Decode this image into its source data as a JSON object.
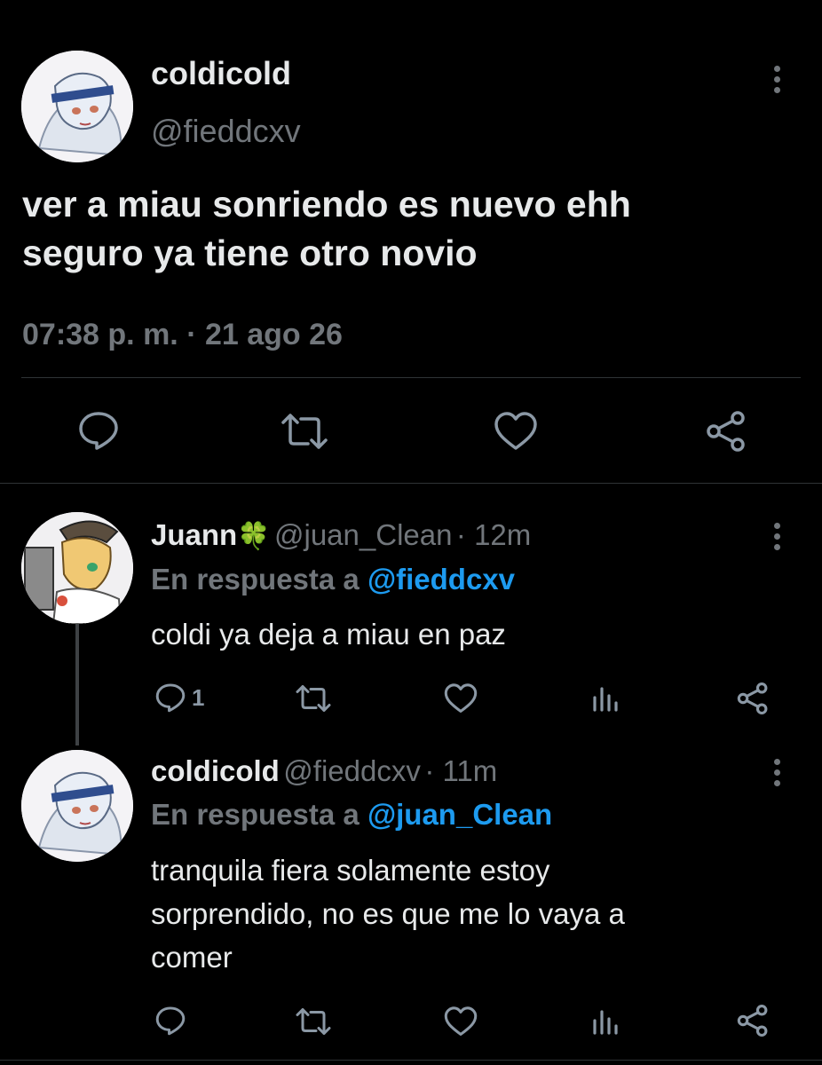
{
  "main_tweet": {
    "display_name": "coldicold",
    "handle": "@fieddcxv",
    "text_line1": "ver a miau sonriendo es nuevo ehh",
    "text_line2": "seguro ya tiene otro novio",
    "timestamp": "07:38 p. m. · 21 ago 26",
    "actions": [
      "reply-icon",
      "retweet-icon",
      "like-icon",
      "share-icon"
    ]
  },
  "replies": [
    {
      "display_name": "Juann",
      "name_emoji": "🍀",
      "handle": "@juan_Clean",
      "time": "· 12m",
      "reply_prefix": "En respuesta a",
      "reply_to": "@fieddcxv",
      "text_lines": [
        "coldi ya deja a miau en paz"
      ],
      "reply_count": "1"
    },
    {
      "display_name": "coldicold",
      "handle": "@fieddcxv",
      "time": "· 11m",
      "reply_prefix": "En respuesta a",
      "reply_to": "@juan_Clean",
      "text_lines": [
        "tranquila fiera solamente estoy",
        "sorprendido, no es que me lo vaya a",
        "comer"
      ]
    }
  ],
  "colors": {
    "background": "#000000",
    "text": "#e7e9ea",
    "secondary": "#71767b",
    "link": "#1d9bf0",
    "clover": "#2fbf4a"
  }
}
